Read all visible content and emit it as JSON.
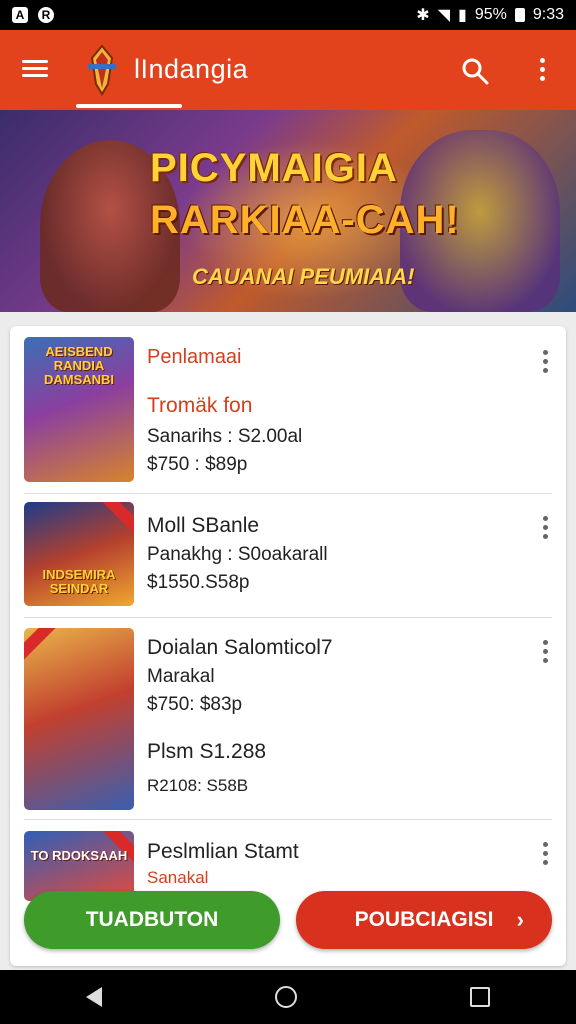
{
  "status_bar": {
    "left_icons": [
      "a-icon",
      "r-icon"
    ],
    "battery": "95%",
    "time": "9:33"
  },
  "app_bar": {
    "title": "lIndangia"
  },
  "banner": {
    "line1": "PICYMAIGIA",
    "line2": "RARKIAA-CAH!",
    "line3": "CAUANAI PEUMIAIA!"
  },
  "items": [
    {
      "thumb_text": "AEISBEND RANDIA DAMSANBI",
      "title": "Penlamaai",
      "subtitle": "Tromäk fon",
      "line3": "Sanarihs : S2.00al",
      "line4": "$750 : $89p"
    },
    {
      "thumb_text": "INDSEMIRA SEINDAR",
      "title": "Moll SBanle",
      "line2": "Panakhg : S0oakarall",
      "line3": "$1550.S58p"
    },
    {
      "title": "Doialan Salomticol7",
      "line2": "Marakal",
      "line3": "$750: $83p",
      "line4": "Plsm S1.288",
      "line5": "R2108: S58B"
    },
    {
      "thumb_text": "TO RDOKSAAH",
      "title": "Peslmlian Stamt",
      "line2": "Sanakal"
    }
  ],
  "buttons": {
    "left_label": "TUADBUTON",
    "right_label": "POUBCIAGISI",
    "right_chevron": "›"
  },
  "colors": {
    "app_bar": "#e2431d",
    "accent_text": "#d2401d",
    "green_button": "#3f9b2a",
    "red_button": "#d8321f"
  }
}
